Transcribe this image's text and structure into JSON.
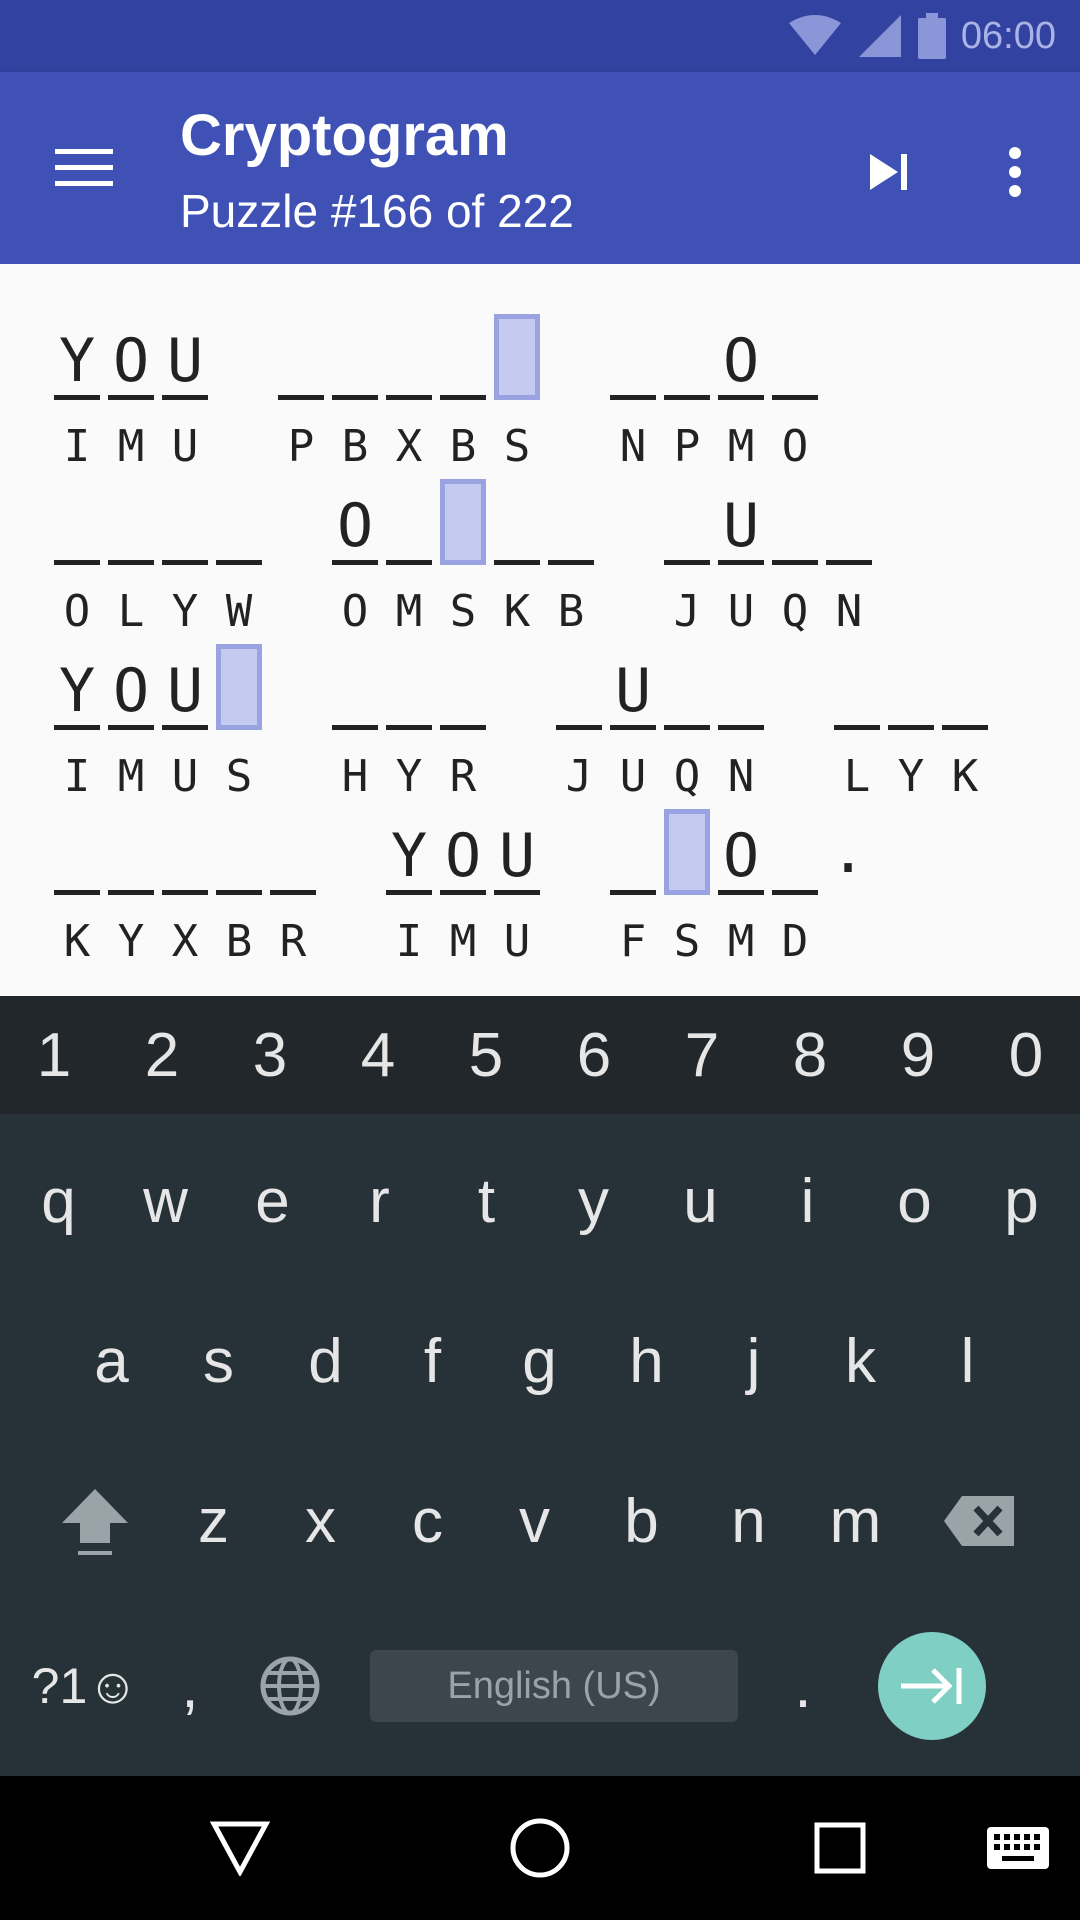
{
  "status_bar": {
    "time": "06:00"
  },
  "app_bar": {
    "title": "Cryptogram",
    "subtitle": "Puzzle #166 of 222"
  },
  "puzzle": {
    "lines": [
      {
        "words": [
          {
            "plain": [
              "Y",
              "O",
              "U"
            ],
            "cipher": [
              "I",
              "M",
              "U"
            ],
            "highlight": []
          },
          {
            "plain": [
              "",
              "",
              "",
              "",
              ""
            ],
            "cipher": [
              "P",
              "B",
              "X",
              "B",
              "S"
            ],
            "highlight": [
              4
            ]
          },
          {
            "plain": [
              "",
              "",
              "O",
              ""
            ],
            "cipher": [
              "N",
              "P",
              "M",
              "O"
            ],
            "highlight": []
          }
        ]
      },
      {
        "words": [
          {
            "plain": [
              "",
              "",
              "",
              ""
            ],
            "cipher": [
              "O",
              "L",
              "Y",
              "W"
            ],
            "highlight": []
          },
          {
            "plain": [
              "O",
              "",
              "",
              "",
              ""
            ],
            "cipher": [
              "O",
              "M",
              "S",
              "K",
              "B"
            ],
            "highlight": [
              2
            ]
          },
          {
            "plain": [
              "",
              "U",
              "",
              ""
            ],
            "cipher": [
              "J",
              "U",
              "Q",
              "N"
            ],
            "highlight": []
          }
        ]
      },
      {
        "words": [
          {
            "plain": [
              "Y",
              "O",
              "U",
              ""
            ],
            "cipher": [
              "I",
              "M",
              "U",
              "S"
            ],
            "highlight": [
              3
            ]
          },
          {
            "plain": [
              "",
              "",
              ""
            ],
            "cipher": [
              "H",
              "Y",
              "R"
            ],
            "highlight": []
          },
          {
            "plain": [
              "",
              "U",
              "",
              ""
            ],
            "cipher": [
              "J",
              "U",
              "Q",
              "N"
            ],
            "highlight": []
          },
          {
            "plain": [
              "",
              "",
              ""
            ],
            "cipher": [
              "L",
              "Y",
              "K"
            ],
            "highlight": []
          }
        ]
      },
      {
        "words": [
          {
            "plain": [
              "",
              "",
              "",
              "",
              ""
            ],
            "cipher": [
              "K",
              "Y",
              "X",
              "B",
              "R"
            ],
            "highlight": []
          },
          {
            "plain": [
              "Y",
              "O",
              "U"
            ],
            "cipher": [
              "I",
              "M",
              "U"
            ],
            "highlight": []
          },
          {
            "plain": [
              "",
              "",
              "O",
              ""
            ],
            "cipher": [
              "F",
              "S",
              "M",
              "D"
            ],
            "highlight": [
              1
            ],
            "punct": "."
          }
        ]
      }
    ]
  },
  "keyboard": {
    "numbers": [
      "1",
      "2",
      "3",
      "4",
      "5",
      "6",
      "7",
      "8",
      "9",
      "0"
    ],
    "row1": [
      "q",
      "w",
      "e",
      "r",
      "t",
      "y",
      "u",
      "i",
      "o",
      "p"
    ],
    "row2": [
      "a",
      "s",
      "d",
      "f",
      "g",
      "h",
      "j",
      "k",
      "l"
    ],
    "row3": [
      "z",
      "x",
      "c",
      "v",
      "b",
      "n",
      "m"
    ],
    "symbols_label": "?1☺",
    "comma": ",",
    "space_label": "English (US)",
    "period": "."
  },
  "icons": {
    "menu": "menu-icon",
    "skip": "skip-next-icon",
    "overflow": "more-vert-icon",
    "shift": "shift-icon",
    "backspace": "backspace-icon",
    "globe": "globe-icon",
    "enter": "tab-next-icon",
    "back": "back-icon",
    "home": "home-icon",
    "recents": "recents-icon",
    "keyboard": "keyboard-icon"
  },
  "colors": {
    "status_bar": "#3242a0",
    "app_bar": "#3f51b5",
    "highlight": "#c5caf0",
    "keyboard_bg": "#263238",
    "enter_key": "#7fcfc4"
  }
}
